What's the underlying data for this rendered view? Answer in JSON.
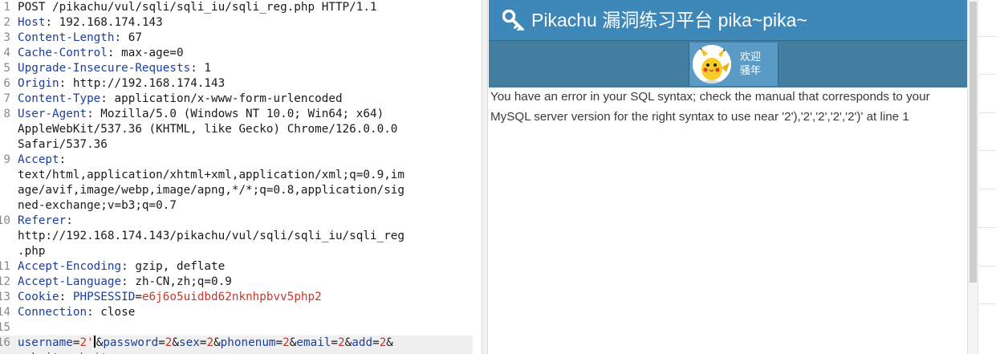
{
  "request": {
    "lines": [
      {
        "num": "1",
        "parts": [
          {
            "t": "POST /pikachu/vul/sqli/sqli_iu/sqli_reg.php HTTP/1.1",
            "c": "hval"
          }
        ]
      },
      {
        "num": "2",
        "parts": [
          {
            "t": "Host",
            "c": "hname"
          },
          {
            "t": ": 192.168.174.143",
            "c": "hval"
          }
        ]
      },
      {
        "num": "3",
        "parts": [
          {
            "t": "Content-Length",
            "c": "hname"
          },
          {
            "t": ": 67",
            "c": "hval"
          }
        ]
      },
      {
        "num": "4",
        "parts": [
          {
            "t": "Cache-Control",
            "c": "hname"
          },
          {
            "t": ": max-age=0",
            "c": "hval"
          }
        ]
      },
      {
        "num": "5",
        "parts": [
          {
            "t": "Upgrade-Insecure-Requests",
            "c": "hname"
          },
          {
            "t": ": 1",
            "c": "hval"
          }
        ]
      },
      {
        "num": "6",
        "parts": [
          {
            "t": "Origin",
            "c": "hname"
          },
          {
            "t": ": http://192.168.174.143",
            "c": "hval"
          }
        ]
      },
      {
        "num": "7",
        "parts": [
          {
            "t": "Content-Type",
            "c": "hname"
          },
          {
            "t": ": application/x-www-form-urlencoded",
            "c": "hval"
          }
        ]
      },
      {
        "num": "8",
        "parts": [
          {
            "t": "User-Agent",
            "c": "hname"
          },
          {
            "t": ": Mozilla/5.0 (Windows NT 10.0; Win64; x64)",
            "c": "hval"
          }
        ]
      },
      {
        "num": "",
        "parts": [
          {
            "t": "AppleWebKit/537.36 (KHTML, like Gecko) Chrome/126.0.0.0",
            "c": "hval"
          }
        ]
      },
      {
        "num": "",
        "parts": [
          {
            "t": "Safari/537.36",
            "c": "hval"
          }
        ]
      },
      {
        "num": "9",
        "parts": [
          {
            "t": "Accept",
            "c": "hname"
          },
          {
            "t": ":",
            "c": "hval"
          }
        ]
      },
      {
        "num": "",
        "parts": [
          {
            "t": "text/html,application/xhtml+xml,application/xml;q=0.9,im",
            "c": "hval"
          }
        ]
      },
      {
        "num": "",
        "parts": [
          {
            "t": "age/avif,image/webp,image/apng,*/*;q=0.8,application/sig",
            "c": "hval"
          }
        ]
      },
      {
        "num": "",
        "parts": [
          {
            "t": "ned-exchange;v=b3;q=0.7",
            "c": "hval"
          }
        ]
      },
      {
        "num": "10",
        "parts": [
          {
            "t": "Referer",
            "c": "hname"
          },
          {
            "t": ":",
            "c": "hval"
          }
        ]
      },
      {
        "num": "",
        "parts": [
          {
            "t": "http://192.168.174.143/pikachu/vul/sqli/sqli_iu/sqli_reg",
            "c": "hval"
          }
        ]
      },
      {
        "num": "",
        "parts": [
          {
            "t": ".php",
            "c": "hval"
          }
        ]
      },
      {
        "num": "11",
        "parts": [
          {
            "t": "Accept-Encoding",
            "c": "hname"
          },
          {
            "t": ": gzip, deflate",
            "c": "hval"
          }
        ]
      },
      {
        "num": "12",
        "parts": [
          {
            "t": "Accept-Language",
            "c": "hname"
          },
          {
            "t": ": zh-CN,zh;q=0.9",
            "c": "hval"
          }
        ]
      },
      {
        "num": "13",
        "parts": [
          {
            "t": "Cookie",
            "c": "hname"
          },
          {
            "t": ": ",
            "c": "hval"
          },
          {
            "t": "PHPSESSID",
            "c": "hname"
          },
          {
            "t": "=",
            "c": "hval"
          },
          {
            "t": "e6j6o5uidbd62nknhpbvv5php2",
            "c": "cval"
          }
        ]
      },
      {
        "num": "14",
        "parts": [
          {
            "t": "Connection",
            "c": "hname"
          },
          {
            "t": ": close",
            "c": "hval"
          }
        ]
      },
      {
        "num": "15",
        "parts": []
      },
      {
        "num": "16",
        "hl": true,
        "parts": [
          {
            "t": "username",
            "c": "pname"
          },
          {
            "t": "=",
            "c": "amp"
          },
          {
            "t": "2'",
            "c": "pval"
          },
          {
            "caret": true
          },
          {
            "t": "&",
            "c": "amp"
          },
          {
            "t": "password",
            "c": "pname"
          },
          {
            "t": "=",
            "c": "amp"
          },
          {
            "t": "2",
            "c": "pval"
          },
          {
            "t": "&",
            "c": "amp"
          },
          {
            "t": "sex",
            "c": "pname"
          },
          {
            "t": "=",
            "c": "amp"
          },
          {
            "t": "2",
            "c": "pval"
          },
          {
            "t": "&",
            "c": "amp"
          },
          {
            "t": "phonenum",
            "c": "pname"
          },
          {
            "t": "=",
            "c": "amp"
          },
          {
            "t": "2",
            "c": "pval"
          },
          {
            "t": "&",
            "c": "amp"
          },
          {
            "t": "email",
            "c": "pname"
          },
          {
            "t": "=",
            "c": "amp"
          },
          {
            "t": "2",
            "c": "pval"
          },
          {
            "t": "&",
            "c": "amp"
          },
          {
            "t": "add",
            "c": "pname"
          },
          {
            "t": "=",
            "c": "amp"
          },
          {
            "t": "2",
            "c": "pval"
          },
          {
            "t": "&",
            "c": "amp"
          }
        ]
      },
      {
        "num": "",
        "hl": true,
        "parts": [
          {
            "t": "submit",
            "c": "pname"
          },
          {
            "t": "=",
            "c": "amp"
          },
          {
            "t": "submit",
            "c": "pval"
          }
        ]
      }
    ]
  },
  "response": {
    "header": {
      "title": "Pikachu 漏洞练习平台 pika~pika~",
      "icon": "key-icon"
    },
    "user": {
      "welcome": "欢迎",
      "name": "骚年",
      "avatar": "pikachu-avatar"
    },
    "error_text": "You have an error in your SQL syntax; check the manual that corresponds to your MySQL server version for the right syntax to use near '2'),'2','2','2','2')' at line 1"
  },
  "colors": {
    "header_bg": "#3e87b9",
    "subbar_bg": "#437ea1",
    "user_bg": "#5a9bc6",
    "header_name": "#1c3f9c",
    "value_red": "#c0392b"
  }
}
